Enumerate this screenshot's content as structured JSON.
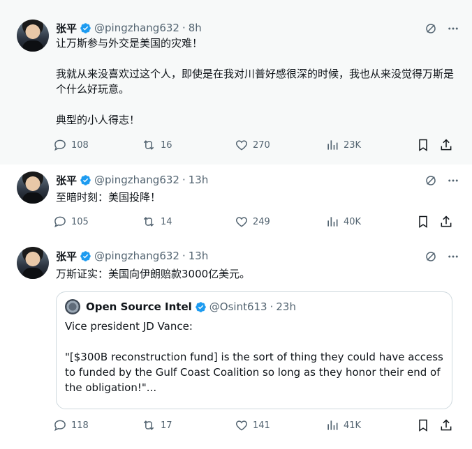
{
  "colors": {
    "accent": "#1d9bf0",
    "muted": "#536471",
    "text": "#0f1419",
    "border": "#cfd9de"
  },
  "tweets": [
    {
      "name": "张平",
      "handle": "@pingzhang632",
      "time": "8h",
      "text": "让万斯参与外交是美国的灾难！\n\n我就从来没喜欢过这个人，即使是在我对川普好感很深的时候，我也从来没觉得万斯是个什么好玩意。\n\n典型的小人得志！",
      "replies": "108",
      "reposts": "16",
      "likes": "270",
      "views": "23K"
    },
    {
      "name": "张平",
      "handle": "@pingzhang632",
      "time": "13h",
      "text": "至暗时刻：美国投降！",
      "replies": "105",
      "reposts": "14",
      "likes": "249",
      "views": "40K"
    },
    {
      "name": "张平",
      "handle": "@pingzhang632",
      "time": "13h",
      "text": "万斯证实：美国向伊朗赔款3000亿美元。",
      "quote": {
        "name": "Open Source Intel",
        "handle": "@Osint613",
        "time": "23h",
        "text": "Vice president JD Vance:\n\n\"[$300B reconstruction fund] is the sort of thing they could have access to funded by the Gulf Coast Coalition so long as they honor their end of the obligation!\"..."
      },
      "replies": "118",
      "reposts": "17",
      "likes": "141",
      "views": "41K"
    }
  ],
  "separator": "·"
}
